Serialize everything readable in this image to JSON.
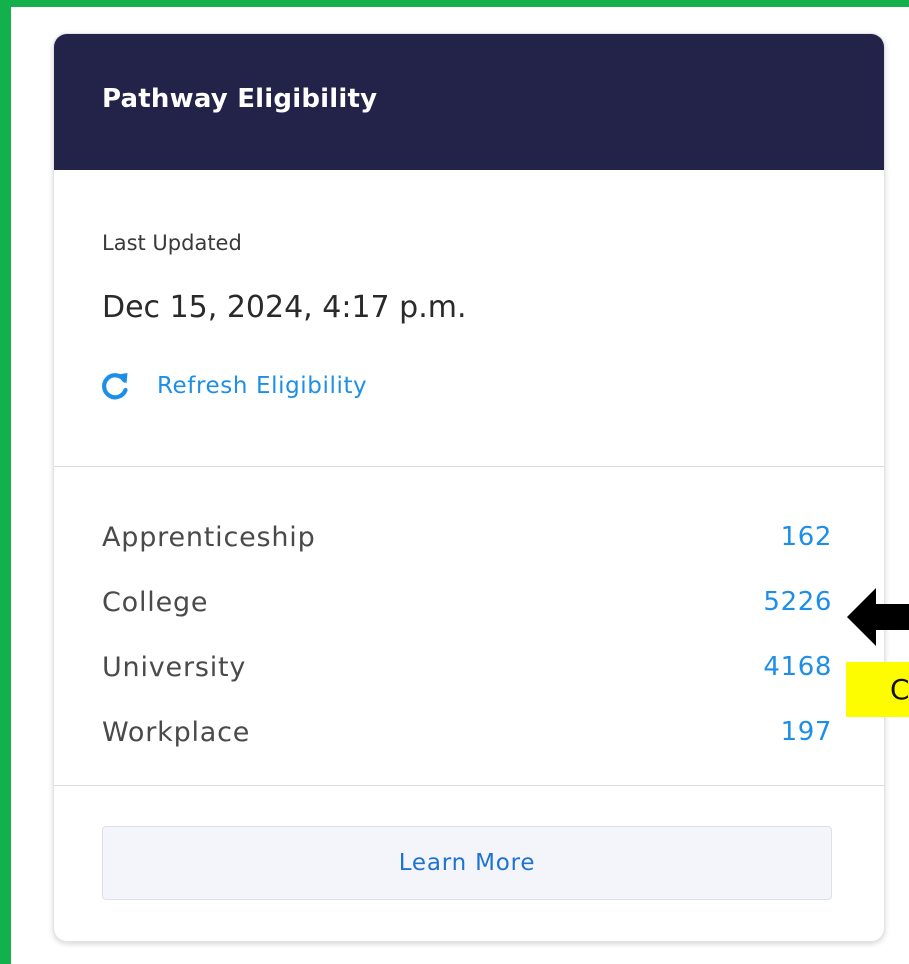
{
  "card": {
    "title": "Pathway Eligibility",
    "last_updated_label": "Last Updated",
    "last_updated_value": "Dec 15, 2024, 4:17 p.m.",
    "refresh_label": "Refresh Eligibility",
    "refresh_icon": "refresh-icon",
    "stats": [
      {
        "label": "Apprenticeship",
        "value": "162"
      },
      {
        "label": "College",
        "value": "5226"
      },
      {
        "label": "University",
        "value": "4168"
      },
      {
        "label": "Workplace",
        "value": "197"
      }
    ],
    "learn_more_label": "Learn More"
  },
  "annotation": {
    "arrow_icon": "left-arrow-icon",
    "note_text": "C"
  },
  "colors": {
    "frame": "#12b14b",
    "header_bg": "#23234a",
    "link": "#1e8fe8",
    "annotation_highlight": "#fdfd00"
  }
}
